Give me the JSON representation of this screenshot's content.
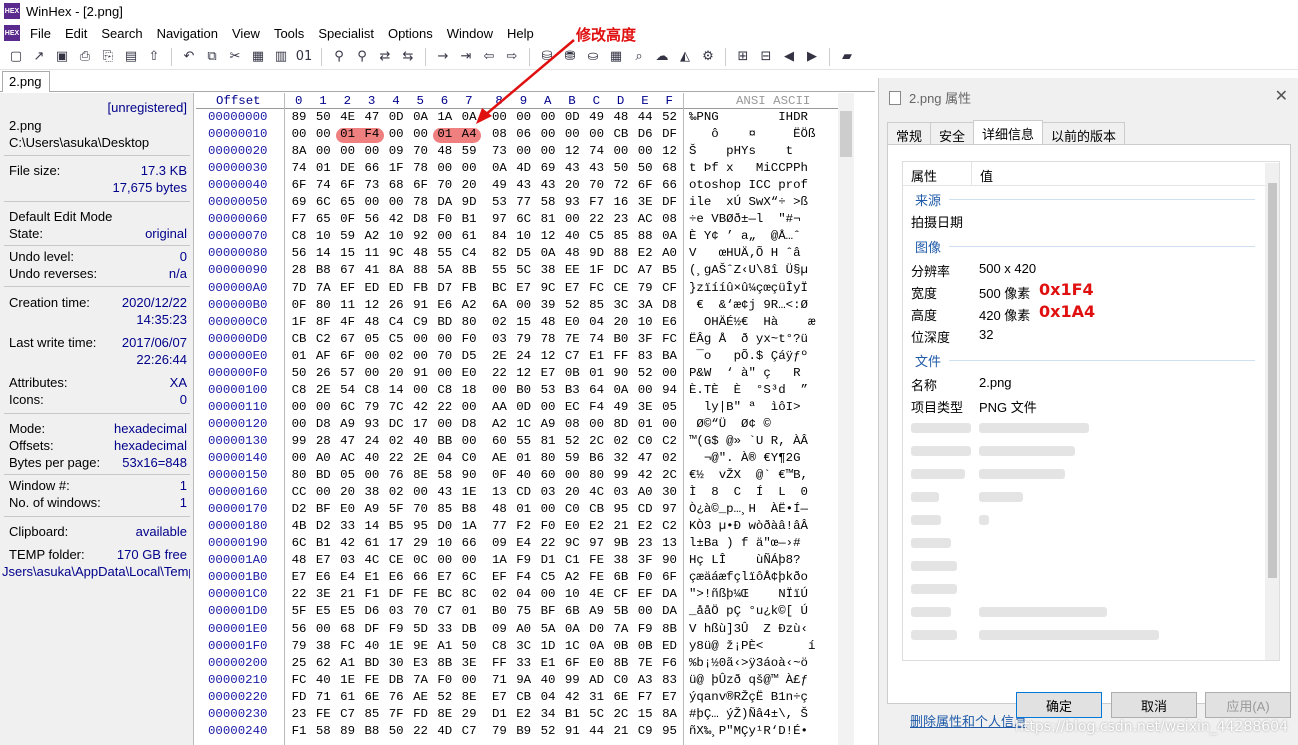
{
  "titlebar": {
    "logo": "HEX",
    "title": "WinHex - [2.png]"
  },
  "menu": [
    "File",
    "Edit",
    "Search",
    "Navigation",
    "View",
    "Tools",
    "Specialist",
    "Options",
    "Window",
    "Help"
  ],
  "tab": "2.png",
  "sidebar": {
    "unregistered": "[unregistered]",
    "filename": "2.png",
    "path": "C:\\Users\\asuka\\Desktop",
    "filesize_label": "File size:",
    "filesize_kb": "17.3 KB",
    "filesize_bytes": "17,675 bytes",
    "edit_mode": "Default Edit Mode",
    "state_label": "State:",
    "state": "original",
    "undo_level_label": "Undo level:",
    "undo_level": "0",
    "undo_rev_label": "Undo reverses:",
    "undo_rev": "n/a",
    "ctime_label": "Creation time:",
    "ctime_date": "2020/12/22",
    "ctime_time": "14:35:23",
    "wtime_label": "Last write time:",
    "wtime_date": "2017/06/07",
    "wtime_time": "22:26:44",
    "attr_label": "Attributes:",
    "attr": "XA",
    "icons_label": "Icons:",
    "icons": "0",
    "mode_label": "Mode:",
    "mode": "hexadecimal",
    "offsets_label": "Offsets:",
    "offsets": "hexadecimal",
    "bpp_label": "Bytes per page:",
    "bpp": "53x16=848",
    "window_label": "Window #:",
    "window": "1",
    "nwin_label": "No. of windows:",
    "nwin": "1",
    "clip_label": "Clipboard:",
    "clip": "available",
    "temp_label": "TEMP folder:",
    "temp": "170 GB free",
    "temp_path": "Jsers\\asuka\\AppData\\Local\\Temp"
  },
  "hex": {
    "offset_header": "Offset",
    "cols": [
      "0",
      "1",
      "2",
      "3",
      "4",
      "5",
      "6",
      "7",
      "8",
      "9",
      "A",
      "B",
      "C",
      "D",
      "E",
      "F"
    ],
    "ascii_header": "ANSI ASCII",
    "rows": [
      [
        "00000000",
        "89 50 4E 47 0D 0A 1A 0A 00 00 00 0D 49 48 44 52",
        "‰PNG        IHDR"
      ],
      [
        "00000010",
        "00 00 01 F4 00 00 01 A4 08 06 00 00 00 CB D6 DF",
        "   ô    ¤     ËÖß"
      ],
      [
        "00000020",
        "8A 00 00 00 09 70 48 59 73 00 00 12 74 00 00 12",
        "Š    pHYs    t   "
      ],
      [
        "00000030",
        "74 01 DE 66 1F 78 00 00 0A 4D 69 43 43 50 50 68",
        "t Þf x   MiCCPPh"
      ],
      [
        "00000040",
        "6F 74 6F 73 68 6F 70 20 49 43 43 20 70 72 6F 66",
        "otoshop ICC prof"
      ],
      [
        "00000050",
        "69 6C 65 00 00 78 DA 9D 53 77 58 93 F7 16 3E DF",
        "ile  xÚ SwX“÷ >ß"
      ],
      [
        "00000060",
        "F7 65 0F 56 42 D8 F0 B1 97 6C 81 00 22 23 AC 08",
        "÷e VBØð±—l  \"#¬ "
      ],
      [
        "00000070",
        "C8 10 59 A2 10 92 00 61 84 10 12 40 C5 85 88 0A",
        "È Y¢ ’ a„  @Å…ˆ "
      ],
      [
        "00000080",
        "56 14 15 11 9C 48 55 C4 82 D5 0A 48 9D 88 E2 A0",
        "V   œHUÄ‚Õ H ˆâ "
      ],
      [
        "00000090",
        "28 B8 67 41 8A 88 5A 8B 55 5C 38 EE 1F DC A7 B5",
        "(¸gAŠˆZ‹U\\8î Ü§µ"
      ],
      [
        "000000A0",
        "7D 7A EF ED ED FB D7 FB BC E7 9C E7 FC CE 79 CF",
        "}zïííû×û¼çœçüÎyÏ"
      ],
      [
        "000000B0",
        "0F 80 11 12 26 91 E6 A2 6A 00 39 52 85 3C 3A D8",
        " €  &‘æ¢j 9R…<:Ø"
      ],
      [
        "000000C0",
        "1F 8F 4F 48 C4 C9 BD 80 02 15 48 E0 04 20 10 E6",
        "  OHÄÉ½€  Hà    æ"
      ],
      [
        "000000D0",
        "CB C2 67 05 C5 00 00 F0 03 79 78 7E 74 B0 3F FC",
        "ËÂg Å  ð yx~t°?ü"
      ],
      [
        "000000E0",
        "01 AF 6F 00 02 00 70 D5 2E 24 12 C7 E1 FF 83 BA",
        " ¯o   pÕ.$ Çáÿƒº"
      ],
      [
        "000000F0",
        "50 26 57 00 20 91 00 E0 22 12 E7 0B 01 90 52 00",
        "P&W  ‘ à\" ç   R "
      ],
      [
        "00000100",
        "C8 2E 54 C8 14 00 C8 18 00 B0 53 B3 64 0A 00 94",
        "È.TÈ  È  °S³d  ”"
      ],
      [
        "00000110",
        "00 00 6C 79 7C 42 22 00 AA 0D 00 EC F4 49 3E 05",
        "  ly|B\" ª  ìôI> "
      ],
      [
        "00000120",
        "00 D8 A9 93 DC 17 00 D8 A2 1C A9 08 00 8D 01 00",
        " Ø©“Ü  Ø¢ ©     "
      ],
      [
        "00000130",
        "99 28 47 24 02 40 BB 00 60 55 81 52 2C 02 C0 C2",
        "™(G$ @» `U R, ÀÂ"
      ],
      [
        "00000140",
        "00 A0 AC 40 22 2E 04 C0 AE 01 80 59 B6 32 47 02",
        "  ¬@\". À® €Y¶2G "
      ],
      [
        "00000150",
        "80 BD 05 00 76 8E 58 90 0F 40 60 00 80 99 42 2C",
        "€½  vŽX  @` €™B,"
      ],
      [
        "00000160",
        "CC 00 20 38 02 00 43 1E 13 CD 03 20 4C 03 A0 30",
        "Ì  8  C  Í  L  0"
      ],
      [
        "00000170",
        "D2 BF E0 A9 5F 70 85 B8 48 01 00 C0 CB 95 CD 97",
        "Ò¿à©_p…¸H  ÀË•Í—"
      ],
      [
        "00000180",
        "4B D2 33 14 B5 95 D0 1A 77 F2 F0 E0 E2 21 E2 C2",
        "KÒ3 µ•Ð wòðàâ!âÂ"
      ],
      [
        "00000190",
        "6C B1 42 61 17 29 10 66 09 E4 22 9C 97 9B 23 13",
        "l±Ba ) f ä\"œ—›# "
      ],
      [
        "000001A0",
        "48 E7 03 4C CE 0C 00 00 1A F9 D1 C1 FE 38 3F 90",
        "Hç LÎ    ùÑÁþ8? "
      ],
      [
        "000001B0",
        "E7 E6 E4 E1 E6 66 E7 6C EF F4 C5 A2 FE 6B F0 6F",
        "çæäáæfçlïôÅ¢þkðo"
      ],
      [
        "000001C0",
        "22 3E 21 F1 DF FE BC 8C 02 04 00 10 4E CF EF DA",
        "\">!ñßþ¼Œ    NÏïÚ"
      ],
      [
        "000001D0",
        "5F E5 E5 D6 03 70 C7 01 B0 75 BF 6B A9 5B 00 DA",
        "_ååÖ pÇ °u¿k©[ Ú"
      ],
      [
        "000001E0",
        "56 00 68 DF F9 5D 33 DB 09 A0 5A 0A D0 7A F9 8B",
        "V hßù]3Û  Z Ðzù‹"
      ],
      [
        "000001F0",
        "79 38 FC 40 1E 9E A1 50 C8 3C 1D 1C 0A 0B 0B ED",
        "y8ü@ ž¡PÈ<      í"
      ],
      [
        "00000200",
        "25 62 A1 BD 30 E3 8B 3E FF 33 E1 6F E0 8B 7E F6",
        "%b¡½0ã‹>ÿ3áoà‹~ö"
      ],
      [
        "00000210",
        "FC 40 1E FE DB 7A F0 00 71 9A 40 99 AD C0 A3 83",
        "ü@ þÛzð qš@™ À£ƒ"
      ],
      [
        "00000220",
        "FD 71 61 6E 76 AE 52 8E E7 CB 04 42 31 6E F7 E7",
        "ýqanv®RŽçË B1n÷ç"
      ],
      [
        "00000230",
        "23 FE C7 85 7F FD 8E 29 D1 E2 34 B1 5C 2C 15 8A",
        "#þÇ… ýŽ)Ñâ4±\\, Š"
      ],
      [
        "00000240",
        "F1 58 89 B8 50 22 4D C7 79 B9 52 91 44 21 C9 95",
        "ñX‰¸P\"MÇy¹R‘D!É•"
      ]
    ]
  },
  "annotation": "修改高度",
  "dialog": {
    "title": "2.png 属性",
    "tabs": [
      "常规",
      "安全",
      "详细信息",
      "以前的版本"
    ],
    "active_tab": 2,
    "header_prop": "属性",
    "header_val": "值",
    "group_source": "来源",
    "date_taken": "拍摄日期",
    "group_image": "图像",
    "resolution_label": "分辨率",
    "resolution": "500 x 420",
    "width_label": "宽度",
    "width": "500 像素",
    "width_hex": "0x1F4",
    "height_label": "高度",
    "height": "420 像素",
    "height_hex": "0x1A4",
    "depth_label": "位深度",
    "depth": "32",
    "group_file": "文件",
    "name_label": "名称",
    "name": "2.png",
    "type_label": "项目类型",
    "type": "PNG 文件",
    "remove_link": "删除属性和个人信息",
    "ok": "确定",
    "cancel": "取消",
    "apply": "应用(A)"
  },
  "watermark": "https://blog.csdn.net/weixin_44288604"
}
